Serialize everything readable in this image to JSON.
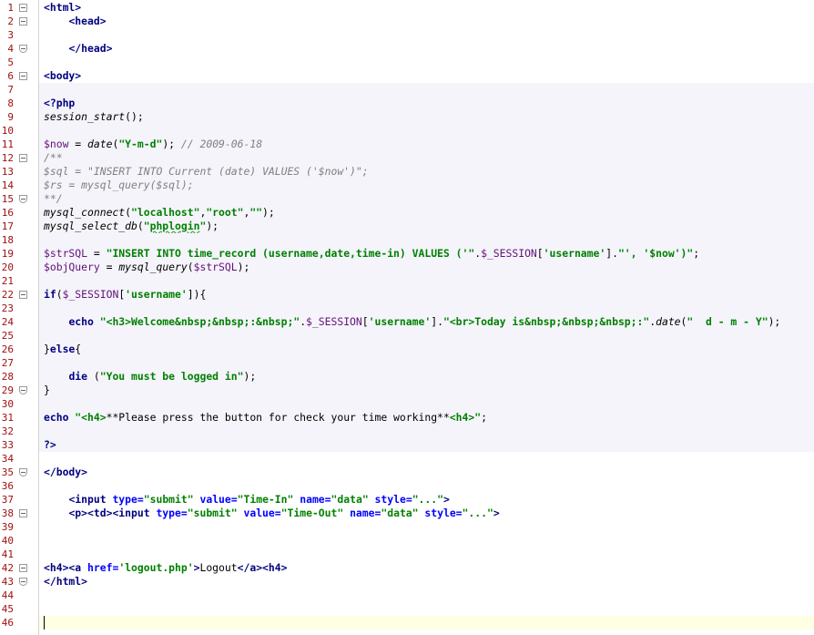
{
  "editor": {
    "line_numbers": [
      "1",
      "2",
      "3",
      "4",
      "5",
      "6",
      "7",
      "8",
      "9",
      "10",
      "11",
      "12",
      "13",
      "14",
      "15",
      "16",
      "17",
      "18",
      "19",
      "20",
      "21",
      "22",
      "23",
      "24",
      "25",
      "26",
      "27",
      "28",
      "29",
      "30",
      "31",
      "32",
      "33",
      "34",
      "35",
      "36",
      "37",
      "38",
      "39",
      "40",
      "41",
      "42",
      "43",
      "44",
      "45",
      "46"
    ],
    "lines": [
      [
        {
          "t": "tag",
          "v": "<html>"
        }
      ],
      [
        {
          "t": "plain",
          "v": "    "
        },
        {
          "t": "tag",
          "v": "<head>"
        }
      ],
      [],
      [
        {
          "t": "plain",
          "v": "    "
        },
        {
          "t": "tag",
          "v": "</head>"
        }
      ],
      [],
      [
        {
          "t": "tag",
          "v": "<body>"
        }
      ],
      [],
      [
        {
          "t": "kw",
          "v": "<?php"
        }
      ],
      [
        {
          "t": "fn",
          "v": "session_start"
        },
        {
          "t": "plain",
          "v": "();"
        }
      ],
      [],
      [
        {
          "t": "var",
          "v": "$now"
        },
        {
          "t": "plain",
          "v": " = "
        },
        {
          "t": "fn",
          "v": "date"
        },
        {
          "t": "plain",
          "v": "("
        },
        {
          "t": "str",
          "v": "\"Y-m-d\""
        },
        {
          "t": "plain",
          "v": "); "
        },
        {
          "t": "cmt",
          "v": "// 2009-06-18"
        }
      ],
      [
        {
          "t": "cmt",
          "v": "/**"
        }
      ],
      [
        {
          "t": "cmt",
          "v": "$sql = \"INSERT INTO Current (date) VALUES ('$now')\";"
        }
      ],
      [
        {
          "t": "cmt",
          "v": "$rs = mysql_query($sql);"
        }
      ],
      [
        {
          "t": "cmt",
          "v": "**/"
        }
      ],
      [
        {
          "t": "fn",
          "v": "mysql_connect"
        },
        {
          "t": "plain",
          "v": "("
        },
        {
          "t": "str",
          "v": "\"localhost\""
        },
        {
          "t": "plain",
          "v": ","
        },
        {
          "t": "str",
          "v": "\"root\""
        },
        {
          "t": "plain",
          "v": ","
        },
        {
          "t": "str",
          "v": "\"\""
        },
        {
          "t": "plain",
          "v": ");"
        }
      ],
      [
        {
          "t": "fn",
          "v": "mysql_select_db"
        },
        {
          "t": "plain",
          "v": "("
        },
        {
          "t": "str",
          "v": "\""
        },
        {
          "t": "str squiggle",
          "v": "phplogin"
        },
        {
          "t": "str",
          "v": "\""
        },
        {
          "t": "plain",
          "v": ");"
        }
      ],
      [],
      [
        {
          "t": "var",
          "v": "$strSQL"
        },
        {
          "t": "plain",
          "v": " = "
        },
        {
          "t": "str",
          "v": "\"INSERT INTO time_record (username,date,time-in) VALUES ('\""
        },
        {
          "t": "plain",
          "v": "."
        },
        {
          "t": "var",
          "v": "$_SESSION"
        },
        {
          "t": "plain",
          "v": "["
        },
        {
          "t": "str",
          "v": "'username'"
        },
        {
          "t": "plain",
          "v": "]."
        },
        {
          "t": "str",
          "v": "\"', '$now')\""
        },
        {
          "t": "plain",
          "v": ";"
        }
      ],
      [
        {
          "t": "var",
          "v": "$objQuery"
        },
        {
          "t": "plain",
          "v": " = "
        },
        {
          "t": "fn",
          "v": "mysql_query"
        },
        {
          "t": "plain",
          "v": "("
        },
        {
          "t": "var",
          "v": "$strSQL"
        },
        {
          "t": "plain",
          "v": ");"
        }
      ],
      [],
      [
        {
          "t": "kw",
          "v": "if"
        },
        {
          "t": "plain",
          "v": "("
        },
        {
          "t": "var",
          "v": "$_SESSION"
        },
        {
          "t": "plain",
          "v": "["
        },
        {
          "t": "str",
          "v": "'username'"
        },
        {
          "t": "plain",
          "v": "]){"
        }
      ],
      [],
      [
        {
          "t": "plain",
          "v": "    "
        },
        {
          "t": "kw",
          "v": "echo"
        },
        {
          "t": "plain",
          "v": " "
        },
        {
          "t": "str",
          "v": "\"<h3>Welcome&nbsp;&nbsp;:&nbsp;\""
        },
        {
          "t": "plain",
          "v": "."
        },
        {
          "t": "var",
          "v": "$_SESSION"
        },
        {
          "t": "plain",
          "v": "["
        },
        {
          "t": "str",
          "v": "'username'"
        },
        {
          "t": "plain",
          "v": "]."
        },
        {
          "t": "str",
          "v": "\"<br>Today is&nbsp;&nbsp;&nbsp;:\""
        },
        {
          "t": "plain",
          "v": "."
        },
        {
          "t": "fn",
          "v": "date"
        },
        {
          "t": "plain",
          "v": "("
        },
        {
          "t": "str",
          "v": "\"  d - m - Y\""
        },
        {
          "t": "plain",
          "v": ");"
        }
      ],
      [],
      [
        {
          "t": "plain",
          "v": "}"
        },
        {
          "t": "kw",
          "v": "else"
        },
        {
          "t": "plain",
          "v": "{"
        }
      ],
      [],
      [
        {
          "t": "plain",
          "v": "    "
        },
        {
          "t": "kw",
          "v": "die"
        },
        {
          "t": "plain",
          "v": " ("
        },
        {
          "t": "str",
          "v": "\"You must be logged in\""
        },
        {
          "t": "plain",
          "v": ");"
        }
      ],
      [
        {
          "t": "plain",
          "v": "}"
        }
      ],
      [],
      [
        {
          "t": "kw",
          "v": "echo"
        },
        {
          "t": "plain",
          "v": " "
        },
        {
          "t": "str",
          "v": "\"<h4>"
        },
        {
          "t": "plain",
          "v": "**Please press the button for check your time working**"
        },
        {
          "t": "str",
          "v": "<h4>\""
        },
        {
          "t": "plain",
          "v": ";"
        }
      ],
      [],
      [
        {
          "t": "kw",
          "v": "?>"
        }
      ],
      [],
      [
        {
          "t": "tag",
          "v": "</body>"
        }
      ],
      [],
      [
        {
          "t": "plain",
          "v": "    "
        },
        {
          "t": "tag",
          "v": "<input "
        },
        {
          "t": "attr",
          "v": "type="
        },
        {
          "t": "str",
          "v": "\"submit\""
        },
        {
          "t": "plain",
          "v": " "
        },
        {
          "t": "attr",
          "v": "value="
        },
        {
          "t": "str",
          "v": "\"Time-In\""
        },
        {
          "t": "plain",
          "v": " "
        },
        {
          "t": "attr",
          "v": "name="
        },
        {
          "t": "str",
          "v": "\"data\""
        },
        {
          "t": "plain",
          "v": " "
        },
        {
          "t": "attr",
          "v": "style="
        },
        {
          "t": "str",
          "v": "\"...\""
        },
        {
          "t": "tag",
          "v": ">"
        }
      ],
      [
        {
          "t": "plain",
          "v": "    "
        },
        {
          "t": "tag",
          "v": "<p><td><input "
        },
        {
          "t": "attr",
          "v": "type="
        },
        {
          "t": "str",
          "v": "\"submit\""
        },
        {
          "t": "plain",
          "v": " "
        },
        {
          "t": "attr",
          "v": "value="
        },
        {
          "t": "str",
          "v": "\"Time-Out\""
        },
        {
          "t": "plain",
          "v": " "
        },
        {
          "t": "attr",
          "v": "name="
        },
        {
          "t": "str",
          "v": "\"data\""
        },
        {
          "t": "plain",
          "v": " "
        },
        {
          "t": "attr",
          "v": "style="
        },
        {
          "t": "str",
          "v": "\"...\""
        },
        {
          "t": "tag",
          "v": ">"
        }
      ],
      [],
      [],
      [],
      [
        {
          "t": "tag",
          "v": "<h4><a "
        },
        {
          "t": "attr",
          "v": "href="
        },
        {
          "t": "str",
          "v": "'logout.php'"
        },
        {
          "t": "tag",
          "v": ">"
        },
        {
          "t": "plain",
          "v": "Logout"
        },
        {
          "t": "tag",
          "v": "</a><h4>"
        }
      ],
      [
        {
          "t": "tag",
          "v": "</html>"
        }
      ],
      [],
      [],
      []
    ],
    "php_block": {
      "from": 7,
      "to": 33
    },
    "caret_line": 46,
    "fold_open_lines": [
      1,
      2,
      6,
      12,
      22,
      38,
      42
    ],
    "fold_end_lines": [
      4,
      15,
      29,
      35,
      43
    ],
    "colors": {
      "line_number": "#a01010",
      "tag": "#000080",
      "attribute": "#0000ff",
      "string": "#008000",
      "comment": "#808080",
      "variable": "#660e7a",
      "php_background": "#f4f4fa",
      "caret_line_background": "#ffffe4"
    }
  }
}
